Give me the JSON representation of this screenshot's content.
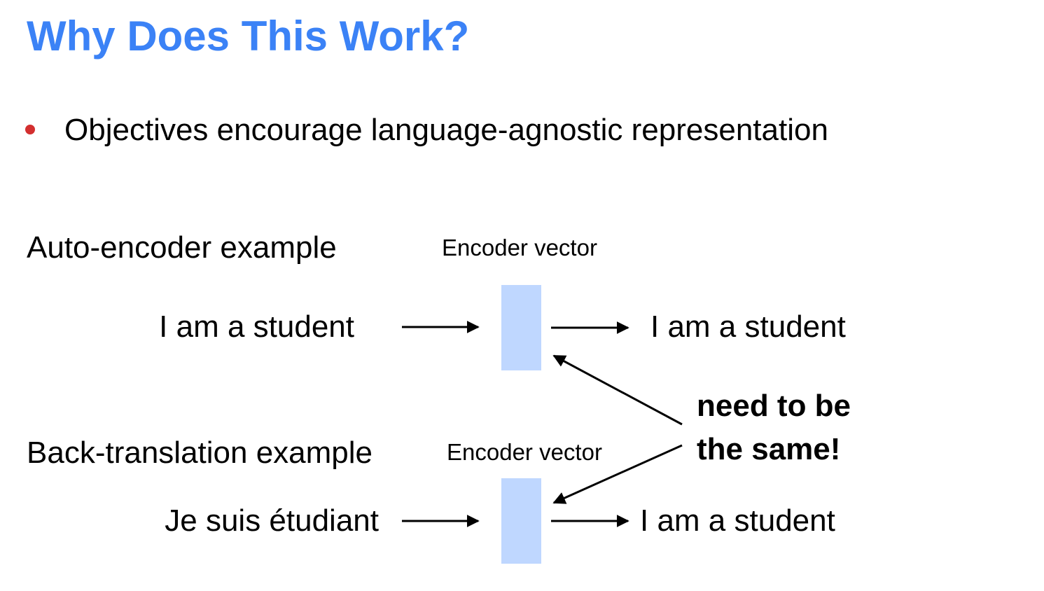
{
  "title": "Why Does This Work?",
  "bullet": {
    "text": "Objectives encourage language-agnostic representation",
    "bullet_color": "#d32f2f"
  },
  "title_color": "#3b82f6",
  "encoder_box_color": "#bfd7ff",
  "autoencoder": {
    "label": "Auto-encoder example",
    "encoder_label": "Encoder vector",
    "input": "I am a student",
    "output": "I am a student"
  },
  "backtranslation": {
    "label": "Back-translation example",
    "encoder_label": "Encoder vector",
    "input": "Je suis étudiant",
    "output": "I am a student"
  },
  "note": {
    "line1": "need to be",
    "line2": "the same!"
  }
}
